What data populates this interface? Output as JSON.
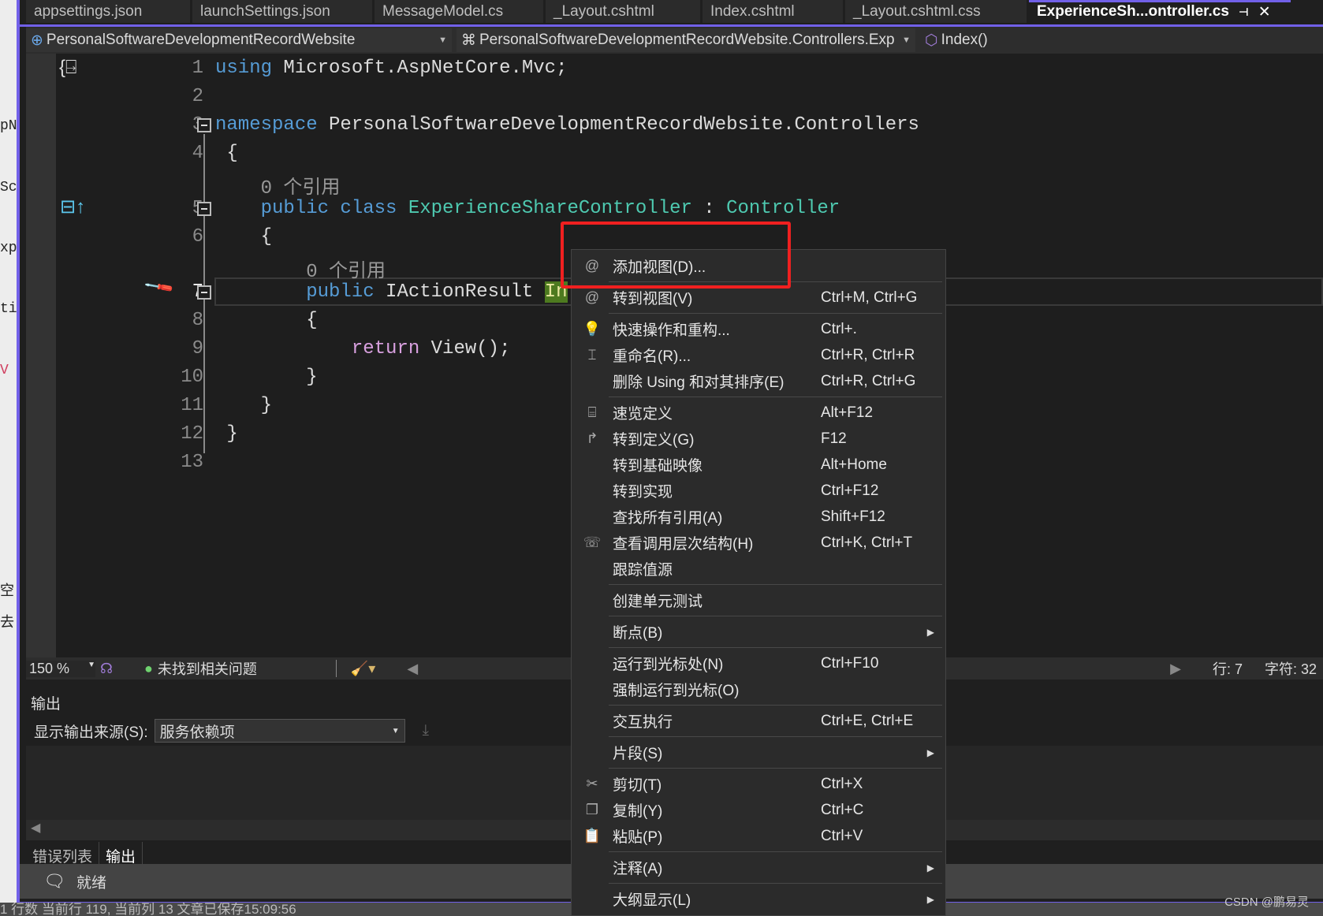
{
  "background_window": {
    "fragments": [
      "pN",
      "Sc",
      "xp",
      "ti",
      "V",
      "空",
      "去"
    ]
  },
  "tabs": [
    {
      "label": "appsettings.json"
    },
    {
      "label": "launchSettings.json"
    },
    {
      "label": "MessageModel.cs"
    },
    {
      "label": "_Layout.cshtml"
    },
    {
      "label": "Index.cshtml"
    },
    {
      "label": "_Layout.cshtml.css"
    },
    {
      "label": "ExperienceSh...ontroller.cs",
      "active": true
    }
  ],
  "tab_icons": {
    "pin": "⊣",
    "close": "✕"
  },
  "nav": {
    "project": "PersonalSoftwareDevelopmentRecordWebsite",
    "class": "PersonalSoftwareDevelopmentRecordWebsite.Controllers.Exp",
    "member": "Index()"
  },
  "code": {
    "lines": [
      {
        "n": "1",
        "t": [
          [
            "kw",
            "using"
          ],
          [
            "pl",
            " Microsoft.AspNetCore.Mvc;"
          ]
        ]
      },
      {
        "n": "2",
        "t": []
      },
      {
        "n": "3",
        "t": [
          [
            "kw",
            "namespace"
          ],
          [
            "pl",
            " PersonalSoftwareDevelopmentRecordWebsite.Controllers"
          ]
        ]
      },
      {
        "n": "4",
        "t": [
          [
            "pl",
            " {"
          ]
        ]
      },
      {
        "lens": "0 个引用",
        "indent": "    "
      },
      {
        "n": "5",
        "t": [
          [
            "pl",
            "    "
          ],
          [
            "kw",
            "public class"
          ],
          [
            "pl",
            " "
          ],
          [
            "ty",
            "ExperienceShareController"
          ],
          [
            "pl",
            " : "
          ],
          [
            "ty",
            "Controller"
          ]
        ]
      },
      {
        "n": "6",
        "t": [
          [
            "pl",
            "    {"
          ]
        ]
      },
      {
        "lens": "0 个引用",
        "indent": "        "
      },
      {
        "n": "7",
        "t": [
          [
            "pl",
            "        "
          ],
          [
            "kw",
            "public"
          ],
          [
            "pl",
            " IActionResult "
          ],
          [
            "hl",
            "In"
          ]
        ],
        "current": true
      },
      {
        "n": "8",
        "t": [
          [
            "pl",
            "        {"
          ]
        ]
      },
      {
        "n": "9",
        "t": [
          [
            "pl",
            "            "
          ],
          [
            "ctl",
            "return"
          ],
          [
            "pl",
            " View();"
          ]
        ]
      },
      {
        "n": "10",
        "t": [
          [
            "pl",
            "        }"
          ]
        ]
      },
      {
        "n": "11",
        "t": [
          [
            "pl",
            "    }"
          ]
        ]
      },
      {
        "n": "12",
        "t": [
          [
            "pl",
            " }"
          ]
        ]
      },
      {
        "n": "13",
        "t": []
      }
    ]
  },
  "editor_status": {
    "zoom": "150 %",
    "issues": "未找到相关问题",
    "line": "行: 7",
    "char": "字符: 32"
  },
  "output": {
    "title": "输出",
    "source_label": "显示输出来源(S):",
    "source_value": "服务依赖项",
    "tabs": [
      {
        "label": "错误列表"
      },
      {
        "label": "输出",
        "active": true
      }
    ]
  },
  "statusbar": {
    "text": "就绪"
  },
  "outer_status": "1 行数   当前行 119, 当前列 13   文章已保存15:09:56",
  "watermark": "CSDN @鹏易灵",
  "highlight_color": "#f02020",
  "context_menu": [
    {
      "icon": "@",
      "label": "添加视图(D)...",
      "shortcut": ""
    },
    {
      "sep": true
    },
    {
      "icon": "@",
      "label": "转到视图(V)",
      "shortcut": "Ctrl+M, Ctrl+G"
    },
    {
      "sep": true
    },
    {
      "icon": "💡",
      "label": "快速操作和重构...",
      "shortcut": "Ctrl+."
    },
    {
      "icon": "⌶",
      "label": "重命名(R)...",
      "shortcut": "Ctrl+R, Ctrl+R"
    },
    {
      "icon": "",
      "label": "删除 Using 和对其排序(E)",
      "shortcut": "Ctrl+R, Ctrl+G"
    },
    {
      "sep": true
    },
    {
      "icon": "⌸",
      "label": "速览定义",
      "shortcut": "Alt+F12"
    },
    {
      "icon": "↱",
      "label": "转到定义(G)",
      "shortcut": "F12"
    },
    {
      "icon": "",
      "label": "转到基础映像",
      "shortcut": "Alt+Home"
    },
    {
      "icon": "",
      "label": "转到实现",
      "shortcut": "Ctrl+F12"
    },
    {
      "icon": "",
      "label": "查找所有引用(A)",
      "shortcut": "Shift+F12"
    },
    {
      "icon": "☏",
      "label": "查看调用层次结构(H)",
      "shortcut": "Ctrl+K, Ctrl+T"
    },
    {
      "icon": "",
      "label": "跟踪值源",
      "shortcut": ""
    },
    {
      "sep": true
    },
    {
      "icon": "",
      "label": "创建单元测试",
      "shortcut": ""
    },
    {
      "sep": true
    },
    {
      "icon": "",
      "label": "断点(B)",
      "shortcut": "",
      "submenu": true
    },
    {
      "sep": true
    },
    {
      "icon": "",
      "label": "运行到光标处(N)",
      "shortcut": "Ctrl+F10"
    },
    {
      "icon": "",
      "label": "强制运行到光标(O)",
      "shortcut": ""
    },
    {
      "sep": true
    },
    {
      "icon": "",
      "label": "交互执行",
      "shortcut": "Ctrl+E, Ctrl+E"
    },
    {
      "sep": true
    },
    {
      "icon": "",
      "label": "片段(S)",
      "shortcut": "",
      "submenu": true
    },
    {
      "sep": true
    },
    {
      "icon": "✂",
      "label": "剪切(T)",
      "shortcut": "Ctrl+X"
    },
    {
      "icon": "❐",
      "label": "复制(Y)",
      "shortcut": "Ctrl+C"
    },
    {
      "icon": "📋",
      "label": "粘贴(P)",
      "shortcut": "Ctrl+V"
    },
    {
      "sep": true
    },
    {
      "icon": "",
      "label": "注释(A)",
      "shortcut": "",
      "submenu": true
    },
    {
      "sep": true
    },
    {
      "icon": "",
      "label": "大纲显示(L)",
      "shortcut": "",
      "submenu": true
    }
  ]
}
